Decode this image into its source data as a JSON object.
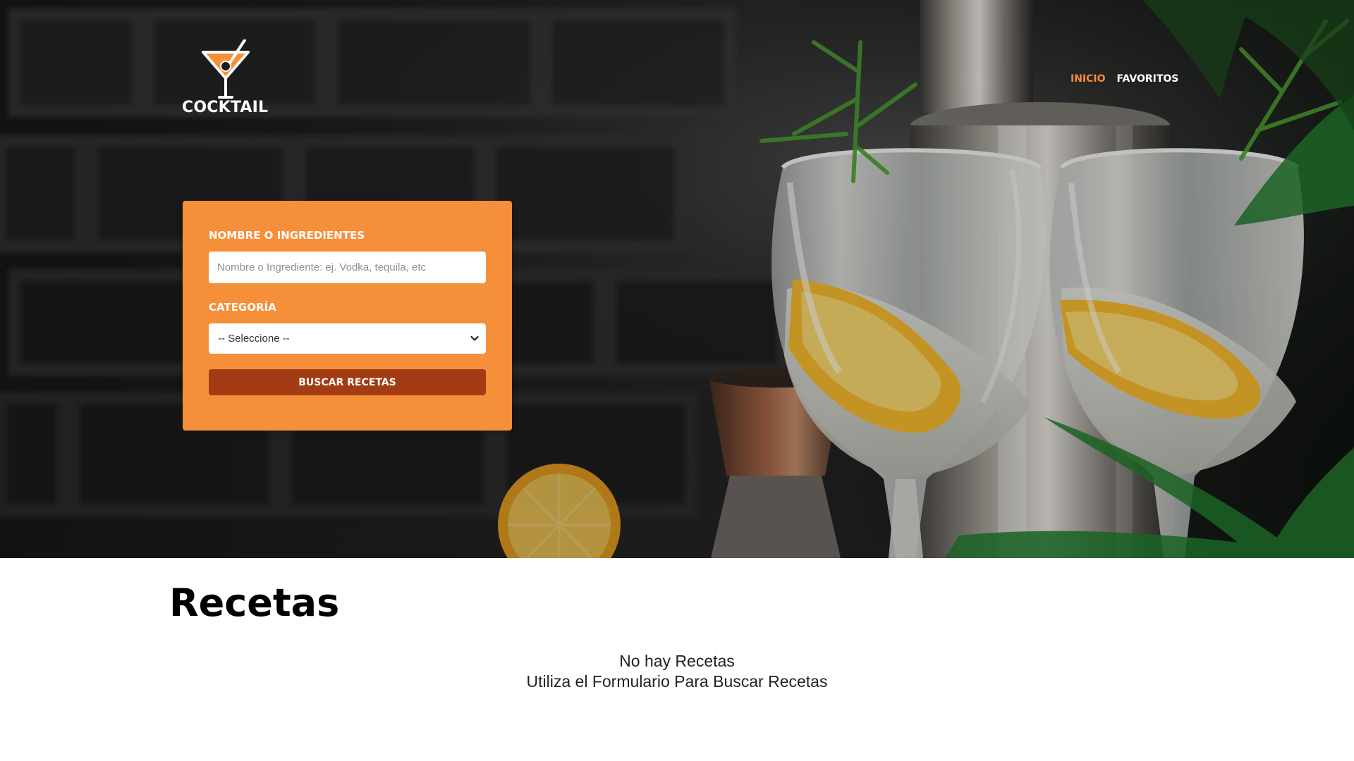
{
  "brand": {
    "name": "COCKTAIL",
    "accent_color": "#f58f3a",
    "button_color": "#a33b14",
    "nav_active_color": "#f68b3a",
    "icon_name": "cocktail-glass-icon"
  },
  "navigation": {
    "items": [
      {
        "label": "INICIO",
        "active": true
      },
      {
        "label": "FAVORITOS",
        "active": false
      }
    ]
  },
  "search": {
    "name_label": "NOMBRE O INGREDIENTES",
    "name_placeholder": "Nombre o Ingrediente: ej. Vodka, tequila, etc",
    "category_label": "CATEGORÍA",
    "category_value": "-- Seleccione --",
    "submit_label": "BUSCAR RECETAS"
  },
  "recipes": {
    "title": "Recetas",
    "empty_message": "No hay Recetas",
    "help_message": "Utiliza el Formulario Para Buscar Recetas"
  }
}
